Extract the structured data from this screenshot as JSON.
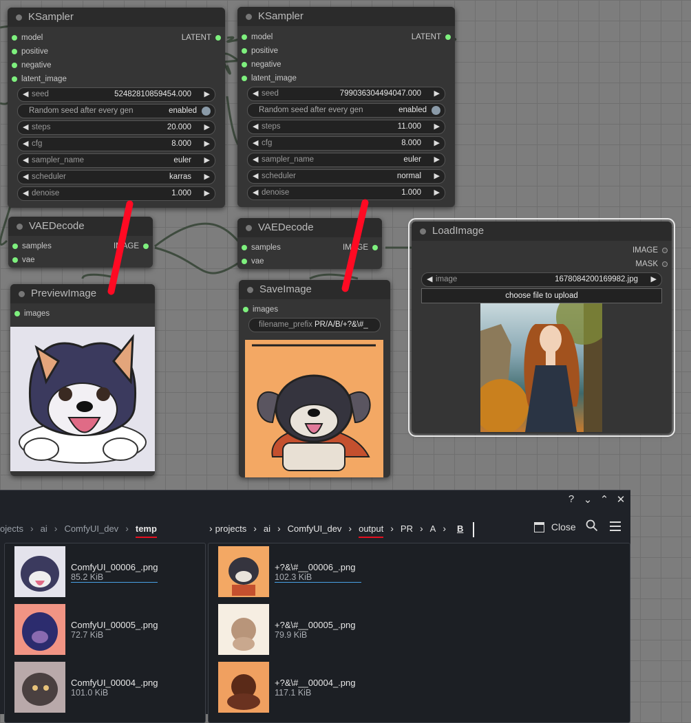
{
  "ksampler1": {
    "title": "KSampler",
    "inputs": [
      "model",
      "positive",
      "negative",
      "latent_image"
    ],
    "output": "LATENT",
    "seed": {
      "label": "seed",
      "value": "52482810859454.000"
    },
    "random_seed": {
      "label": "Random seed after every gen",
      "value": "enabled"
    },
    "steps": {
      "label": "steps",
      "value": "20.000"
    },
    "cfg": {
      "label": "cfg",
      "value": "8.000"
    },
    "sampler_name": {
      "label": "sampler_name",
      "value": "euler"
    },
    "scheduler": {
      "label": "scheduler",
      "value": "karras"
    },
    "denoise": {
      "label": "denoise",
      "value": "1.000"
    }
  },
  "ksampler2": {
    "title": "KSampler",
    "inputs": [
      "model",
      "positive",
      "negative",
      "latent_image"
    ],
    "output": "LATENT",
    "seed": {
      "label": "seed",
      "value": "799036304494047.000"
    },
    "random_seed": {
      "label": "Random seed after every gen",
      "value": "enabled"
    },
    "steps": {
      "label": "steps",
      "value": "11.000"
    },
    "cfg": {
      "label": "cfg",
      "value": "8.000"
    },
    "sampler_name": {
      "label": "sampler_name",
      "value": "euler"
    },
    "scheduler": {
      "label": "scheduler",
      "value": "normal"
    },
    "denoise": {
      "label": "denoise",
      "value": "1.000"
    }
  },
  "vaedecode1": {
    "title": "VAEDecode",
    "inputs": [
      "samples",
      "vae"
    ],
    "output": "IMAGE"
  },
  "vaedecode2": {
    "title": "VAEDecode",
    "inputs": [
      "samples",
      "vae"
    ],
    "output": "IMAGE"
  },
  "preview": {
    "title": "PreviewImage",
    "input": "images"
  },
  "save": {
    "title": "SaveImage",
    "input": "images",
    "prefix_label": "filename_prefix",
    "prefix_value": "PR/A/B/+?&\\#_"
  },
  "load": {
    "title": "LoadImage",
    "outputs": [
      "IMAGE",
      "MASK"
    ],
    "image_label": "image",
    "image_value": "1678084200169982.jpg",
    "upload": "choose file to upload"
  },
  "panel": {
    "window_buttons": [
      "?",
      "⌄",
      "⌃",
      "✕"
    ],
    "left_crumbs": [
      "ojects",
      "ai",
      "ComfyUI_dev",
      "temp"
    ],
    "right_crumbs": [
      "projects",
      "ai",
      "ComfyUI_dev",
      "output",
      "PR",
      "A",
      "B"
    ],
    "close_label": "Close",
    "left_files": [
      {
        "name": "ComfyUI_00006_.png",
        "size": "85.2 KiB"
      },
      {
        "name": "ComfyUI_00005_.png",
        "size": "72.7 KiB"
      },
      {
        "name": "ComfyUI_00004_.png",
        "size": "101.0 KiB"
      }
    ],
    "right_files": [
      {
        "name": "+?&\\#__00006_.png",
        "size": "102.3 KiB"
      },
      {
        "name": "+?&\\#__00005_.png",
        "size": "79.9 KiB"
      },
      {
        "name": "+?&\\#__00004_.png",
        "size": "117.1 KiB"
      }
    ]
  },
  "colors": {
    "canvas": "#7d7d7d",
    "node": "#353535",
    "slot": "#7ef07e",
    "annotation": "#ff0a23",
    "panel": "#1f2228"
  }
}
